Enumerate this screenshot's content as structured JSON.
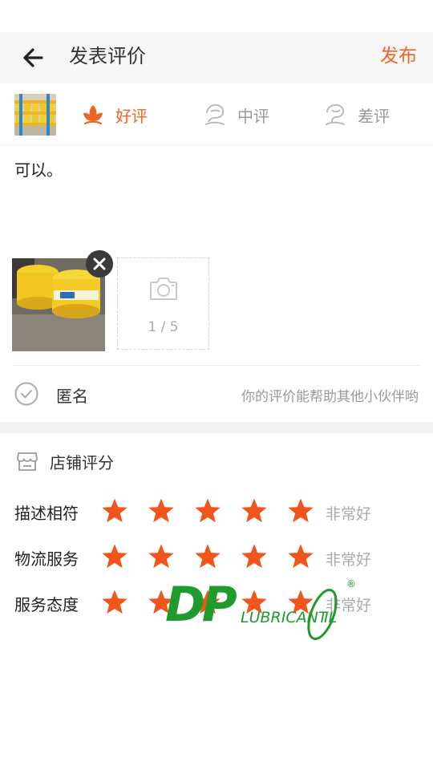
{
  "header": {
    "title": "发表评价",
    "publish_label": "发布"
  },
  "rating": {
    "good_label": "好评",
    "mid_label": "中评",
    "bad_label": "差评",
    "accent_color": "#f06522",
    "inactive_color": "#999999"
  },
  "comment": {
    "text": "可以。"
  },
  "photos": {
    "count_label": "1 / 5"
  },
  "anonymous": {
    "label": "匿名",
    "hint": "你的评价能帮助其他小伙伴哟"
  },
  "store": {
    "title": "店铺评分",
    "rows": [
      {
        "name": "描述相符",
        "stars": 5,
        "level": "非常好"
      },
      {
        "name": "物流服务",
        "stars": 5,
        "level": "非常好"
      },
      {
        "name": "服务态度",
        "stars": 5,
        "level": "非常好"
      }
    ]
  },
  "watermark": {
    "text": "DP LUBRICANT OIL ®"
  },
  "icons": {
    "back": "arrow-left-icon",
    "good": "flower-icon",
    "mid": "neutral-flower-icon",
    "bad": "wilted-flower-icon",
    "camera": "camera-icon",
    "check": "check-circle-icon",
    "store": "store-icon",
    "star": "star-icon"
  }
}
